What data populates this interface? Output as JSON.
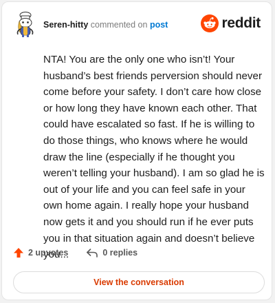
{
  "header": {
    "username": "Seren-hitty",
    "action_text": "commented on",
    "post_link": "post"
  },
  "brand": {
    "icon": "reddit-alien-icon",
    "name": "reddit",
    "color": "#ff4500"
  },
  "comment": {
    "body": "NTA! You are the only one who isn’t! Your husband’s best friends perversion should never come before your safety. I don’t care how close or how long they have known each other. That could have escalated so fast. If he is willing to do those things, who knows where he would draw the line (especially if he thought you weren’t telling your husband). I am so glad he is out of your life and you can feel safe in your own home again. I really hope your husband now gets it and you should run if he ever puts you in that situation again and doesn’t believe you..."
  },
  "stats": {
    "upvotes": "2 upvotes",
    "upvote_icon": "upvote-arrow-icon",
    "replies": "0 replies",
    "reply_icon": "reply-arrow-icon"
  },
  "cta": {
    "label": "View the conversation"
  },
  "colors": {
    "accent": "#d93a00",
    "link": "#0079d3",
    "upvote": "#ff4500"
  }
}
